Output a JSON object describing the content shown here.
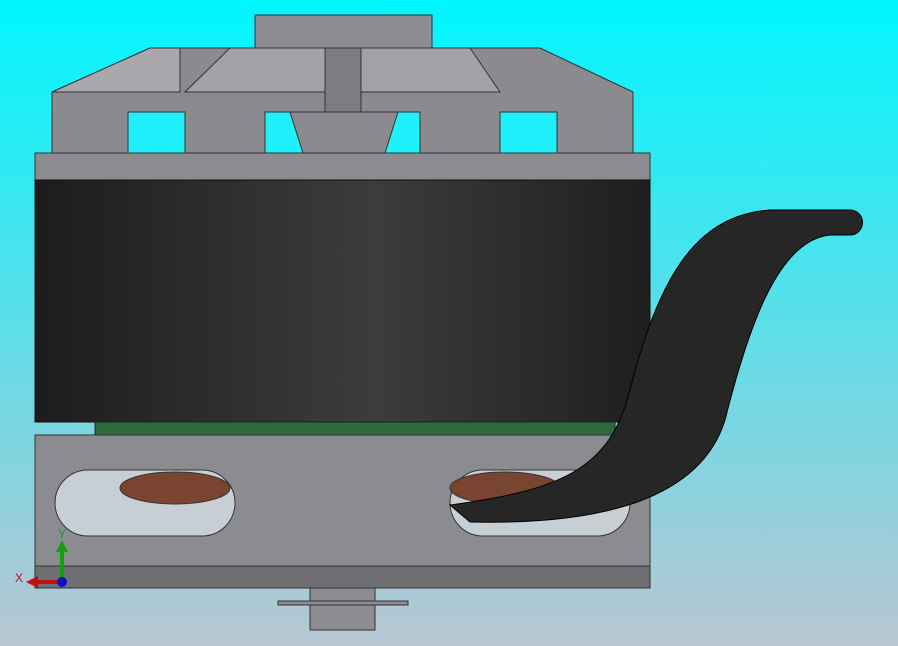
{
  "viewport": {
    "background_top": "#00f6ff",
    "background_bottom": "#b9c6d2"
  },
  "triad": {
    "x_label": "X",
    "y_label": "Y",
    "x_color": "#c01010",
    "y_color": "#10a010",
    "z_color": "#1010c0"
  },
  "model": {
    "housing_color": "#8a8a8e",
    "can_color": "#2a2a2a",
    "winding_color": "#7a4530",
    "stator_color": "#2f6b3a"
  }
}
